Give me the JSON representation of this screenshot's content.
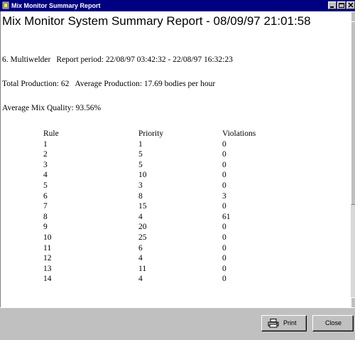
{
  "window": {
    "title": "Mix Monitor Summary Report"
  },
  "report": {
    "title": "Mix Monitor System Summary Report - 08/09/97 21:01:58",
    "station": "6. Multiwelder",
    "period": "Report period: 22/08/97 03:42:32 - 22/08/97 16:32:23",
    "total_production": "Total Production: 62",
    "average_production": "Average Production: 17.69 bodies per hour",
    "average_mix_quality": "Average Mix Quality: 93.56%",
    "columns": [
      "Rule",
      "Priority",
      "Violations"
    ],
    "rows": [
      [
        "1",
        "1",
        "0"
      ],
      [
        "2",
        "5",
        "0"
      ],
      [
        "3",
        "5",
        "0"
      ],
      [
        "4",
        "10",
        "0"
      ],
      [
        "5",
        "3",
        "0"
      ],
      [
        "6",
        "8",
        "3"
      ],
      [
        "7",
        "15",
        "0"
      ],
      [
        "8",
        "4",
        "61"
      ],
      [
        "9",
        "20",
        "0"
      ],
      [
        "10",
        "25",
        "0"
      ],
      [
        "11",
        "6",
        "0"
      ],
      [
        "12",
        "4",
        "0"
      ],
      [
        "13",
        "11",
        "0"
      ],
      [
        "14",
        "4",
        "0"
      ]
    ]
  },
  "buttons": {
    "print": "Print",
    "close": "Close"
  },
  "icons": {
    "app": "app-icon",
    "minimize": "minimize-icon",
    "maximize": "maximize-icon",
    "close": "close-icon",
    "printer": "printer-icon"
  },
  "colors": {
    "titlebar": "#000080",
    "face": "#c0c0c0",
    "content": "#ffffff"
  }
}
